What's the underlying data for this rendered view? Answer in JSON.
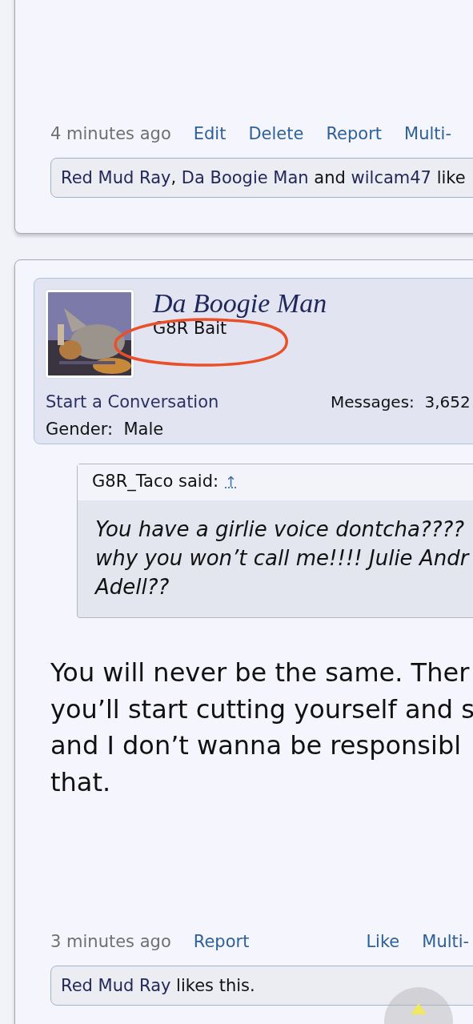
{
  "posts": [
    {
      "meta": [
        {
          "kind": "time",
          "text": "4 minutes ago"
        },
        {
          "kind": "link",
          "text": "Edit"
        },
        {
          "kind": "link",
          "text": "Delete"
        },
        {
          "kind": "link",
          "text": "Report"
        },
        {
          "kind": "link",
          "text": "Multi-"
        }
      ],
      "likes": [
        {
          "kind": "user",
          "text": "Red Mud Ray"
        },
        {
          "kind": "text",
          "text": ", "
        },
        {
          "kind": "user",
          "text": "Da Boogie Man"
        },
        {
          "kind": "text",
          "text": " and "
        },
        {
          "kind": "user",
          "text": "wilcam47"
        },
        {
          "kind": "text",
          "text": " like"
        }
      ]
    },
    {
      "author": {
        "name": "Da Boogie Man",
        "title": "G8R Bait",
        "start_conversation": "Start a Conversation",
        "messages_label": "Messages:",
        "messages": "3,652",
        "gender_label": "Gender:",
        "gender": "Male"
      },
      "quote": {
        "header": "G8R_Taco said:",
        "jump": "↑",
        "lines": [
          "You have a girlie voice dontcha????",
          "why you won’t call me!!!! Julie Andr",
          "Adell??"
        ]
      },
      "body_lines": [
        "You will never be the same. Ther",
        "you’ll start cutting yourself and s",
        "and I don’t wanna be responsibl",
        "that."
      ],
      "meta": [
        {
          "kind": "time",
          "text": "3 minutes ago"
        },
        {
          "kind": "link",
          "text": "Report"
        }
      ],
      "meta_right": [
        {
          "kind": "link",
          "text": "Like"
        },
        {
          "kind": "link",
          "text": "Multi-"
        }
      ],
      "likes": [
        {
          "kind": "user",
          "text": "Red Mud Ray"
        },
        {
          "kind": "text",
          "text": " likes this."
        }
      ]
    }
  ]
}
